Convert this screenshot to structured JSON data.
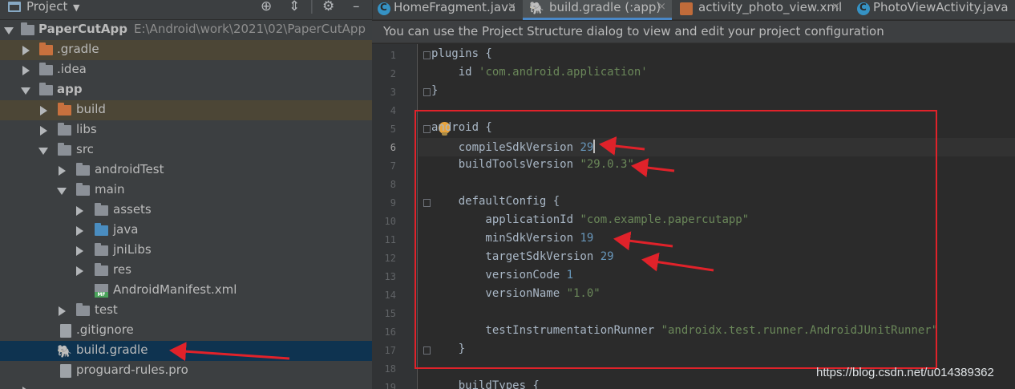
{
  "project_panel": {
    "title": "Project",
    "tree": [
      {
        "label": "PaperCutApp",
        "path": "E:\\Android\\work\\2021\\02\\PaperCutApp",
        "bold": true
      },
      {
        "label": ".gradle"
      },
      {
        "label": ".idea"
      },
      {
        "label": "app",
        "bold": true
      },
      {
        "label": "build"
      },
      {
        "label": "libs"
      },
      {
        "label": "src"
      },
      {
        "label": "androidTest"
      },
      {
        "label": "main"
      },
      {
        "label": "assets"
      },
      {
        "label": "java"
      },
      {
        "label": "jniLibs"
      },
      {
        "label": "res"
      },
      {
        "label": "AndroidManifest.xml"
      },
      {
        "label": "test"
      },
      {
        "label": ".gitignore"
      },
      {
        "label": "build.gradle"
      },
      {
        "label": "proguard-rules.pro"
      }
    ],
    "manifest_badge": "MF"
  },
  "tabs": [
    {
      "label": "HomeFragment.java",
      "close": "×"
    },
    {
      "label": "build.gradle (:app)",
      "close": "×"
    },
    {
      "label": "activity_photo_view.xml",
      "close": "×"
    },
    {
      "label": "PhotoViewActivity.java",
      "close": ""
    }
  ],
  "banner": "You can use the Project Structure dialog to view and edit your project configuration",
  "editor": {
    "current_line": 6,
    "line_numbers": [
      "1",
      "2",
      "3",
      "4",
      "5",
      "6",
      "7",
      "8",
      "9",
      "10",
      "11",
      "12",
      "13",
      "14",
      "15",
      "16",
      "17",
      "18",
      "19"
    ],
    "code": {
      "l1": "plugins {",
      "l2_key": "    id ",
      "l2_val": "'com.android.application'",
      "l3": "}",
      "l5": "android {",
      "l6_key": "    compileSdkVersion ",
      "l6_val": "29",
      "l7_key": "    buildToolsVersion ",
      "l7_val": "\"29.0.3\"",
      "l9": "    defaultConfig {",
      "l10_key": "        applicationId ",
      "l10_val": "\"com.example.papercutapp\"",
      "l11_key": "        minSdkVersion ",
      "l11_val": "19",
      "l12_key": "        targetSdkVersion ",
      "l12_val": "29",
      "l13_key": "        versionCode ",
      "l13_val": "1",
      "l14_key": "        versionName ",
      "l14_val": "\"1.0\"",
      "l16_key": "        testInstrumentationRunner ",
      "l16_val": "\"androidx.test.runner.AndroidJUnitRunner\"",
      "l17": "    }",
      "l19": "    buildTypes {"
    }
  },
  "watermark": "https://blog.csdn.net/u014389362",
  "colors": {
    "annotation_red": "#e0222a",
    "string_green": "#6a8759",
    "number_blue": "#6897bb",
    "selection_blue": "#0e3350"
  },
  "icons": [
    "project-icon",
    "locate-icon",
    "collapse-icon",
    "settings-icon",
    "folder-icon",
    "gradle-icon",
    "manifest-icon",
    "file-icon",
    "class-icon",
    "xml-icon",
    "bulb-icon"
  ]
}
